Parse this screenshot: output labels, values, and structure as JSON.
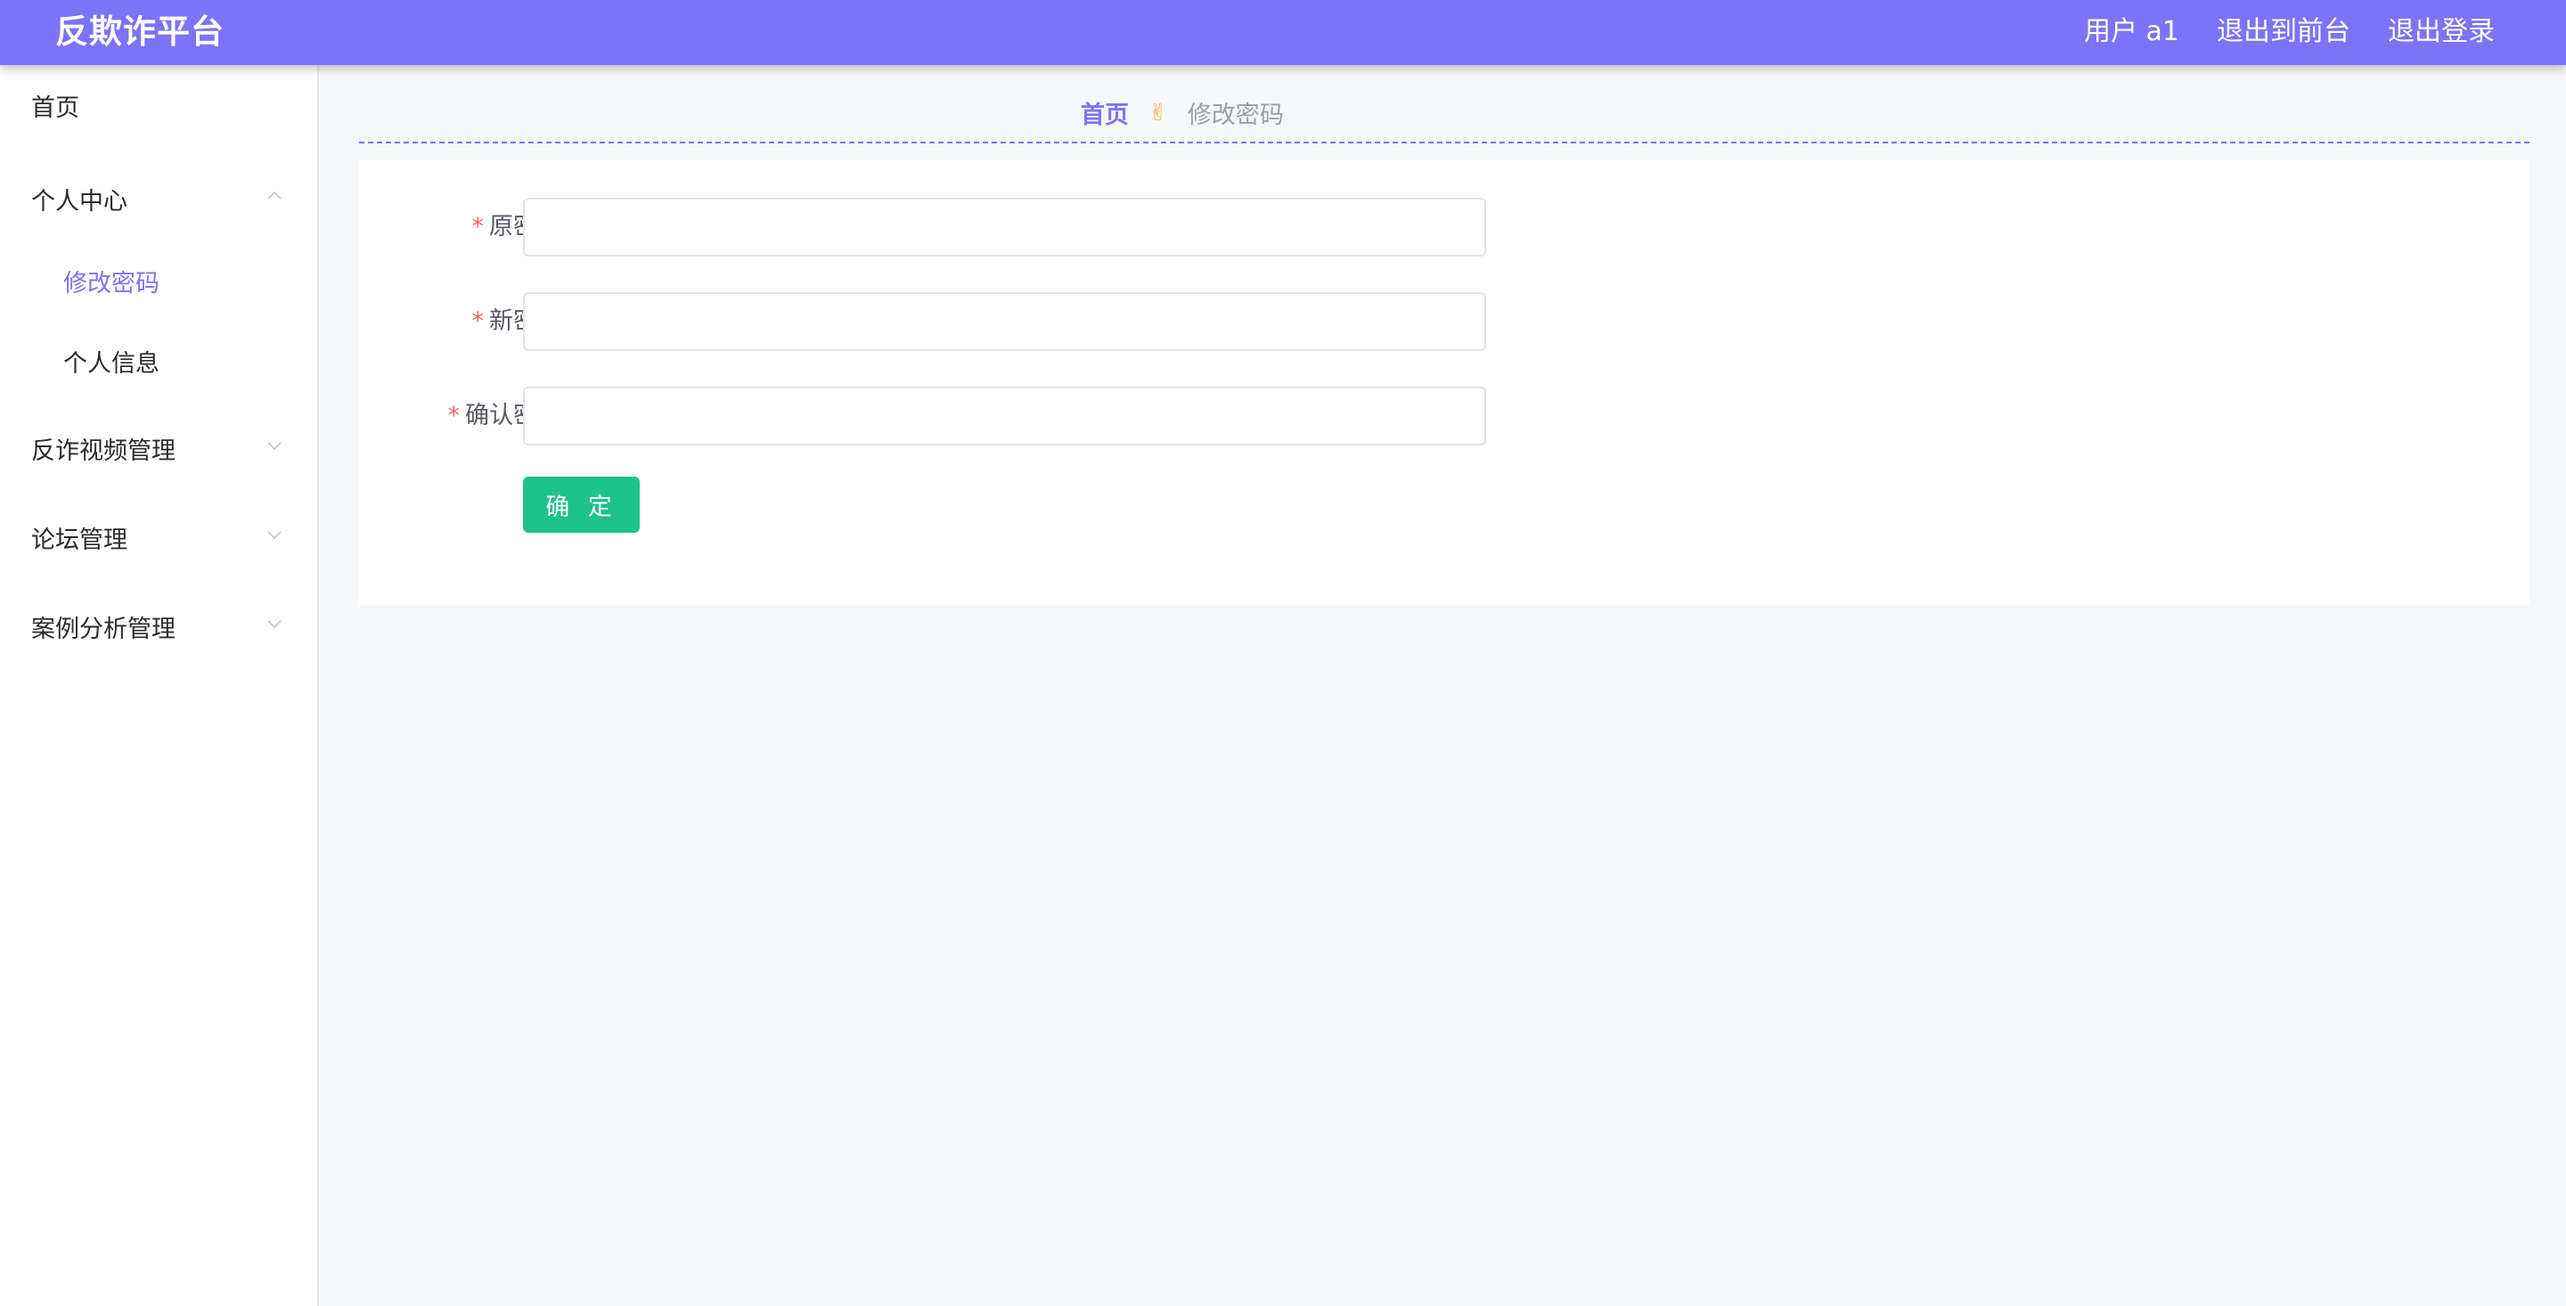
{
  "header": {
    "brand": "反欺诈平台",
    "user": "用户 a1",
    "to_front": "退出到前台",
    "logout": "退出登录"
  },
  "sidebar": {
    "items": [
      {
        "label": "首页"
      },
      {
        "label": "个人中心",
        "expanded": true
      },
      {
        "label": "修改密码",
        "active": true
      },
      {
        "label": "个人信息"
      },
      {
        "label": "反诈视频管理",
        "expanded": false
      },
      {
        "label": "论坛管理",
        "expanded": false
      },
      {
        "label": "案例分析管理",
        "expanded": false
      }
    ]
  },
  "breadcrumb": {
    "home": "首页",
    "separator_icon": "victory-hand-icon",
    "current": "修改密码"
  },
  "form": {
    "required_mark": "*",
    "old_password": {
      "label": "原密码",
      "value": ""
    },
    "new_password": {
      "label": "新密码",
      "value": ""
    },
    "confirm_password": {
      "label": "确认密码",
      "value": ""
    },
    "submit_label": "确 定"
  },
  "colors": {
    "accent": "#7b74f6",
    "button": "#1ec28b",
    "required": "#f06a6a",
    "background": "#f6f7f9"
  }
}
